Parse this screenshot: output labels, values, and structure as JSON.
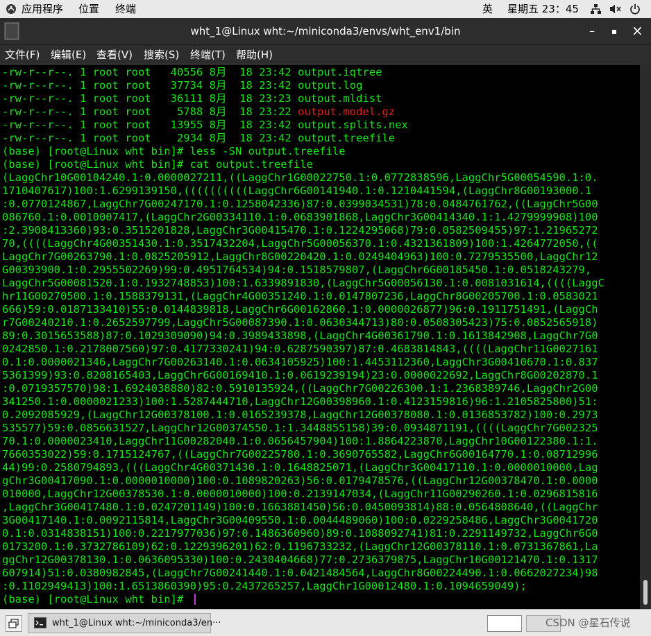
{
  "topbar": {
    "apps": "应用程序",
    "places": "位置",
    "terminal": "终端",
    "ime": "英",
    "clock": "星期五 23：45"
  },
  "window": {
    "title": "wht_1@Linux wht:~/miniconda3/envs/wht_env1/bin",
    "min": "–",
    "max": "▪",
    "close": "×"
  },
  "menu": [
    "文件(F)",
    "编辑(E)",
    "查看(V)",
    "搜索(S)",
    "终端(T)",
    "帮助(H)"
  ],
  "terminal": {
    "lines": [
      {
        "text": "-rw-r--r--. 1 root root   40556 8月  18 23:42 ",
        "file": "output.iqtree"
      },
      {
        "text": "-rw-r--r--. 1 root root   37734 8月  18 23:42 ",
        "file": "output.log"
      },
      {
        "text": "-rw-r--r--. 1 root root   36111 8月  18 23:23 ",
        "file": "output.mldist"
      },
      {
        "text": "-rw-r--r--. 1 root root    5788 8月  18 23:22 ",
        "file": "output.model.gz",
        "red": true
      },
      {
        "text": "-rw-r--r--. 1 root root   13955 8月  18 23:42 ",
        "file": "output.splits.nex"
      },
      {
        "text": "-rw-r--r--. 1 root root    2934 8月  18 23:42 ",
        "file": "output.treefile"
      },
      {
        "text": "(base) [root@Linux wht bin]# less -SN output.treefile"
      },
      {
        "text": "(base) [root@Linux wht bin]# cat output.treefile"
      },
      {
        "text": "(LaggChr10G00104240.1:0.0000027211,((LaggChr1G00022750.1:0.0772838596,LaggChr5G00054590.1:0."
      },
      {
        "text": "1710407617)100:1.6299139150,((((((((((LaggChr6G00141940.1:0.1210441594,(LaggChr8G00193000.1"
      },
      {
        "text": ":0.0770124867,LaggChr7G00247170.1:0.1258042336)87:0.0399034531)78:0.0484761762,((LaggChr5G00"
      },
      {
        "text": "086760.1:0.0010007417,(LaggChr2G00334110.1:0.0683901868,LaggChr3G00414340.1:1.4279999908)100"
      },
      {
        "text": ":2.3908413360)93:0.3515201828,LaggChr3G00415470.1:0.1224295068)79:0.0582509455)97:1.21965272"
      },
      {
        "text": "70,((((LaggChr4G00351430.1:0.3517432204,LaggChr5G00056370.1:0.4321361809)100:1.4264772050,(("
      },
      {
        "text": "LaggChr7G00263790.1:0.0825205912,LaggChr8G00220420.1:0.0249404963)100:0.7279535500,LaggChr12"
      },
      {
        "text": "G00393900.1:0.2955502269)99:0.4951764534)94:0.1518579807,(LaggChr6G00185450.1:0.0518243279,"
      },
      {
        "text": "LaggChr5G00081520.1:0.1932748853)100:1.6339891830,(LaggChr5G00056130.1:0.0081031614,((((LaggC"
      },
      {
        "text": "hr11G00270500.1:0.1588379131,(LaggChr4G00351240.1:0.0147807236,LaggChr8G00205700.1:0.0583021"
      },
      {
        "text": "666)59:0.0187133410)55:0.0144839818,LaggChr6G00162860.1:0.0000026877)96:0.1911751491,(LaggCh"
      },
      {
        "text": "r7G00240210.1:0.2652597799,LaggChr5G00087390.1:0.0630344713)80:0.0508305423)75:0.0852565918)"
      },
      {
        "text": "89:0.3015653588)87:0.1029309090)94:0.3989433898,(LaggChr4G00361790.1:0.1613842908,LaggChr7G0"
      },
      {
        "text": "0242850.1:0.2178007560)97:0.4177330241)94:0.6287590397)87:0.4683814843,((((LaggChr11G0027161"
      },
      {
        "text": "0.1:0.0000021346,LaggChr7G00263140.1:0.0634105925)100:1.4453112360,LaggChr3G00410670.1:0.837"
      },
      {
        "text": "5361399)93:0.8208165403,LaggChr6G00169410.1:0.0619239194)23:0.0000022692,LaggChr8G00202870.1"
      },
      {
        "text": ":0.0719357570)98:1.6924038880)82:0.5910135924,((LaggChr7G00226300.1:1.2368389746,LaggChr2G00"
      },
      {
        "text": "341250.1:0.0000021233)100:1.5287444710,LaggChr12G00398960.1:0.4123159816)96:1.2105825800)51:"
      },
      {
        "text": "0.2092085929,(LaggChr12G00378100.1:0.0165239378,LaggChr12G00378080.1:0.0136853782)100:0.2973"
      },
      {
        "text": "535577)59:0.0856631527,LaggChr12G00374550.1:1.3448855158)39:0.0934871191,((((LaggChr7G002325"
      },
      {
        "text": "70.1:0.0000023410,LaggChr11G00282040.1:0.0656457904)100:1.8864223870,LaggChr10G00122380.1:1."
      },
      {
        "text": "7660353022)59:0.1715124767,((LaggChr7G00225780.1:0.3690765582,LaggChr6G00164770.1:0.08712996"
      },
      {
        "text": "44)99:0.2580794893,(((LaggChr4G00371430.1:0.1648825071,(LaggChr3G00417110.1:0.0000010000,Lag"
      },
      {
        "text": "gChr3G00417090.1:0.0000010000)100:0.1089820263)56:0.0179478576,((LaggChr12G00378470.1:0.0000"
      },
      {
        "text": "010000,LaggChr12G00378530.1:0.0000010000)100:0.2139147034,(LaggChr11G00290260.1:0.0296815816"
      },
      {
        "text": ",LaggChr3G00417480.1:0.0247201149)100:0.1663881450)56:0.0450093814)88:0.0564808640,((LaggChr"
      },
      {
        "text": "3G00417140.1:0.0092115814,LaggChr3G00409550.1:0.0044489060)100:0.0229258486,LaggChr3G0041720"
      },
      {
        "text": "0.1:0.0314838151)100:0.2217977036)97:0.1486360960)89:0.1088092741)81:0.2291149732,LaggChr6G0"
      },
      {
        "text": "0173200.1:0.3732786109)62:0.1229396201)62:0.1196733232,(LaggChr12G00378110.1:0.0731367861,La"
      },
      {
        "text": "ggChr12G00378130.1:0.0636095330)100:0.2430404668)77:0.2736379875,LaggChr10G00121470.1:0.1317"
      },
      {
        "text": "607914)51:0.0380982845,(LaggChr7G00241440.1:0.0421484564,LaggChr8G00224490.1:0.0662027234)98"
      },
      {
        "text": ":0.1102949413)100:1.6513860390)95:0.2437265257,LaggChr1G00012480.1:0.1094659049);"
      },
      {
        "text": "(base) [root@Linux wht bin]# "
      }
    ]
  },
  "taskbar": {
    "window_label": "wht_1@Linux wht:~/miniconda3/en···",
    "watermark": "CSDN @星石传说"
  },
  "colors": {
    "terminal_text": "#16e516",
    "highlight_file": "#e41c1c",
    "terminal_bg": "#000000",
    "cursor": "#c33ad8"
  }
}
